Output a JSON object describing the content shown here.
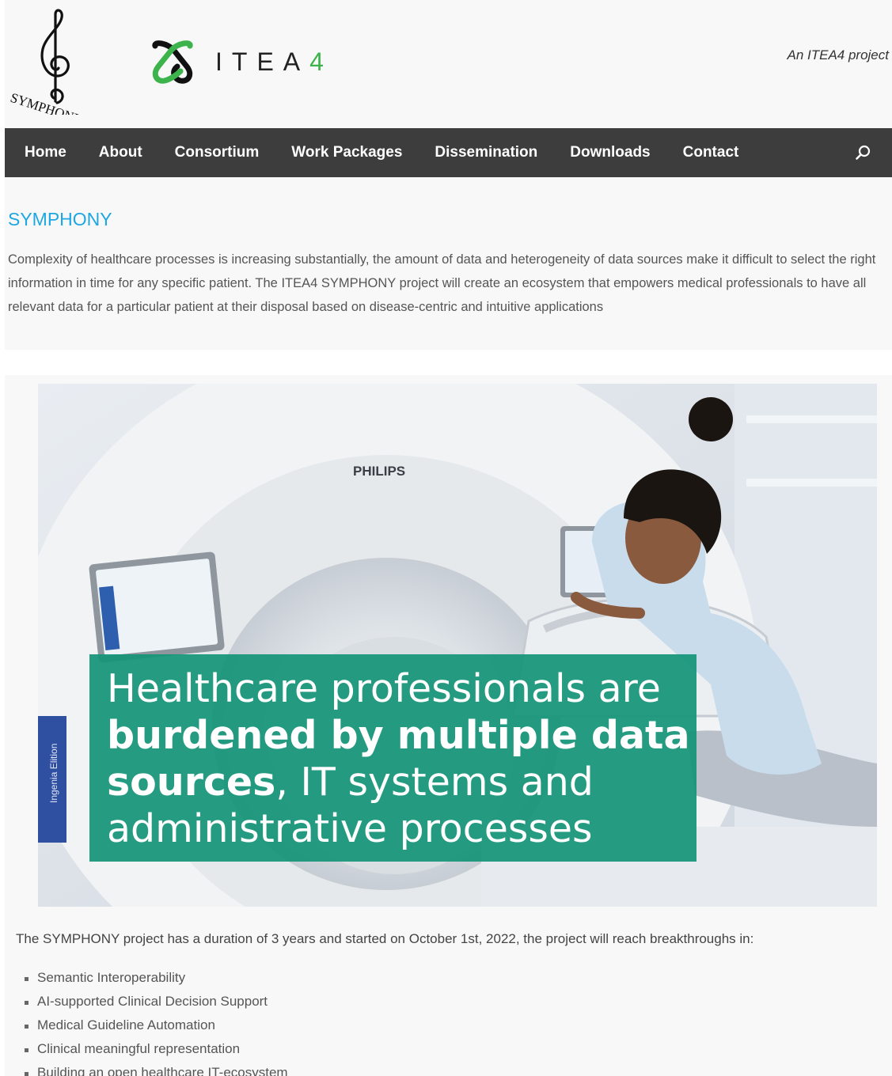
{
  "header": {
    "symphony_logo_text": "SYMPHONY",
    "itea_logo_text": "ITEA",
    "itea_logo_number": "4",
    "tagline": "An ITEA4 project"
  },
  "nav": {
    "items": [
      "Home",
      "About",
      "Consortium",
      "Work Packages",
      "Dissemination",
      "Downloads",
      "Contact"
    ],
    "search_icon": "search-icon"
  },
  "intro": {
    "title": "SYMPHONY",
    "text": "Complexity of healthcare processes is increasing substantially, the amount of data and heterogeneity of data sources make it difficult to select the right information in time for any specific patient. The ITEA4 SYMPHONY project will create an ecosystem that empowers medical professionals to have all relevant data for a particular patient at their disposal based on disease-centric and intuitive applications"
  },
  "hero": {
    "scanner_brand": "PHILIPS",
    "scanner_model": "Ingenia Elition",
    "line1": "Healthcare professionals are",
    "line2_bold": "burdened by multiple data",
    "line3_bold": "sources",
    "line3_rest": ", IT systems and",
    "line4": "administrative processes"
  },
  "main": {
    "duration_text": "The SYMPHONY project has a duration of 3 years and started on October 1st, 2022, the project will reach breakthroughs in:",
    "bullets": [
      "Semantic Interoperability",
      "AI-supported Clinical Decision Support",
      "Medical Guideline Automation",
      "Clinical meaningful representation",
      "Building an open healthcare IT-ecosystem"
    ]
  },
  "colors": {
    "nav_bg": "#3d3d3d",
    "title_blue": "#1ea7e1",
    "hero_green": "#169478",
    "itea_green": "#3cb44b"
  }
}
